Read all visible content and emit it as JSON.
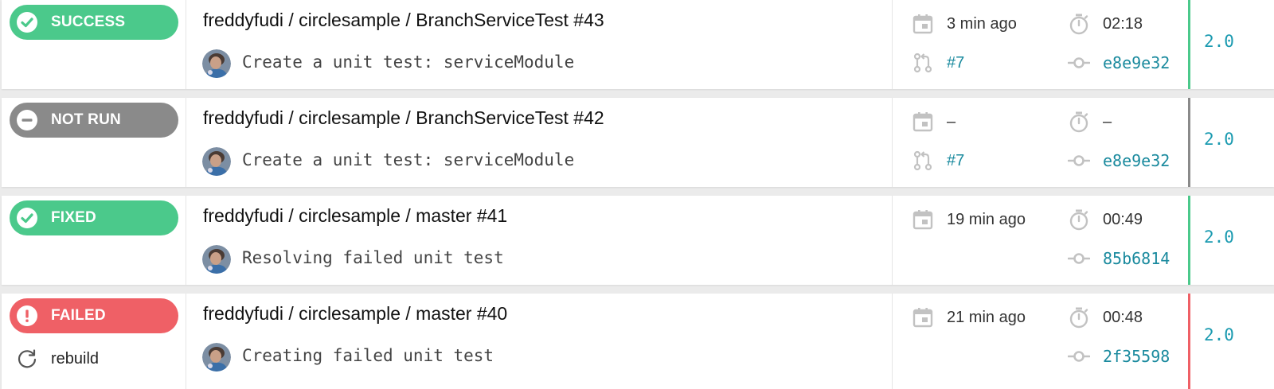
{
  "colors": {
    "success": "#4bc98b",
    "not_run": "#8a8a8a",
    "failed": "#ef6066",
    "link": "#1a8a9e"
  },
  "builds": [
    {
      "status": "SUCCESS",
      "title": "freddyfudi / circlesample / BranchServiceTest #43",
      "commit_message": "Create a unit test: serviceModule",
      "started": "3 min ago",
      "duration": "02:18",
      "pull_request": "#7",
      "commit_hash": "e8e9e32",
      "version": "2.0"
    },
    {
      "status": "NOT RUN",
      "title": "freddyfudi / circlesample / BranchServiceTest #42",
      "commit_message": "Create a unit test: serviceModule",
      "started": "–",
      "duration": "–",
      "pull_request": "#7",
      "commit_hash": "e8e9e32",
      "version": "2.0"
    },
    {
      "status": "FIXED",
      "title": "freddyfudi / circlesample / master #41",
      "commit_message": "Resolving failed unit test",
      "started": "19 min ago",
      "duration": "00:49",
      "commit_hash": "85b6814",
      "version": "2.0"
    },
    {
      "status": "FAILED",
      "title": "freddyfudi / circlesample / master #40",
      "commit_message": "Creating failed unit test",
      "started": "21 min ago",
      "duration": "00:48",
      "commit_hash": "2f35598",
      "version": "2.0",
      "rebuild_label": "rebuild"
    }
  ]
}
